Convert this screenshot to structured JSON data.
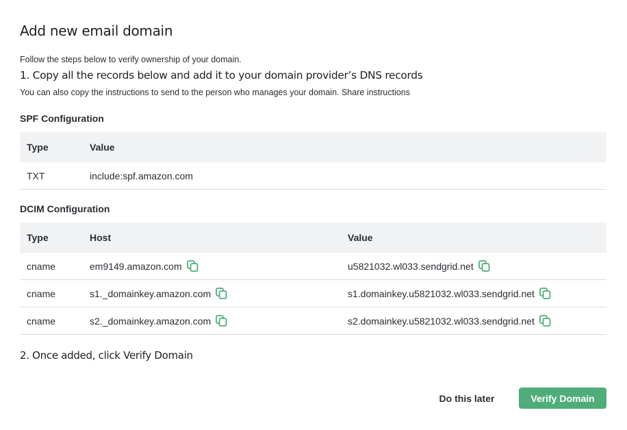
{
  "dialog": {
    "title": "Add new email domain",
    "intro": "Follow the steps below to verify ownership of your domain.",
    "step1_title": "1. Copy all the records below and add it to your domain provider’s DNS records",
    "step1_sub": "You can also copy the instructions to send to the person who manages your domain. Share instructions",
    "step2_title": "2. Once added, click Verify Domain"
  },
  "spf": {
    "title": "SPF Configuration",
    "headers": {
      "type": "Type",
      "value": "Value"
    },
    "rows": [
      {
        "type": "TXT",
        "value": "include:spf.amazon.com"
      }
    ]
  },
  "dcim": {
    "title": "DCIM Configuration",
    "headers": {
      "type": "Type",
      "host": "Host",
      "value": "Value"
    },
    "rows": [
      {
        "type": "cname",
        "host": "em9149.amazon.com",
        "value": "u5821032.wl033.sendgrid.net"
      },
      {
        "type": "cname",
        "host": "s1._domainkey.amazon.com",
        "value": "s1.domainkey.u5821032.wl033.sendgrid.net"
      },
      {
        "type": "cname",
        "host": "s2._domainkey.amazon.com",
        "value": "s2.domainkey.u5821032.wl033.sendgrid.net"
      }
    ],
    "copy_icon": "copy-icon"
  },
  "actions": {
    "later_label": "Do this later",
    "verify_label": "Verify Domain"
  },
  "colors": {
    "accent": "#4fad7a",
    "header_bg": "#f1f2f4",
    "text": "#2a2d33"
  }
}
